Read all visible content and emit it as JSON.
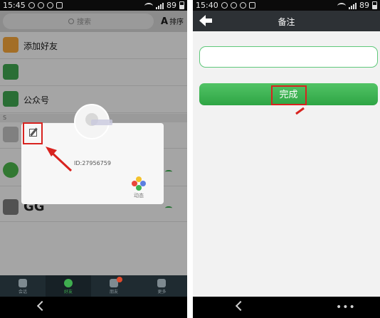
{
  "left_screen": {
    "status_time": "15:45",
    "status_battery": "89",
    "search_placeholder": "搜索",
    "sort_icon_letter": "A",
    "sort_label": "排序",
    "rows": [
      {
        "label": "添加好友",
        "icon_color": "#f0a33a"
      },
      {
        "label": "",
        "icon_color": "#3ea24e"
      },
      {
        "label": "公众号",
        "icon_color": "#3ea24e"
      }
    ],
    "section_letter": "S",
    "row_gg_label": "GG",
    "card": {
      "id_text": "ID:27956759",
      "moments_label": "动态"
    },
    "tabs": [
      {
        "label": "会话"
      },
      {
        "label": "好友"
      },
      {
        "label": "朋友"
      },
      {
        "label": "更多"
      }
    ],
    "colors": {
      "accent": "#3fae4f",
      "highlight": "#d8231f"
    }
  },
  "right_screen": {
    "status_time": "15:40",
    "status_battery": "89",
    "title": "备注",
    "remark_value": "",
    "done_label": "完成",
    "colors": {
      "titlebar": "#2d3135",
      "button": "#3db553"
    }
  }
}
